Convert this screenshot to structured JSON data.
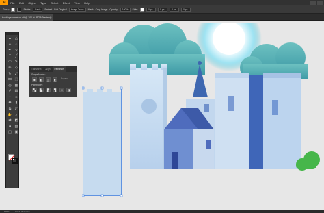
{
  "app": {
    "logo": "Ai"
  },
  "menu": [
    "File",
    "Edit",
    "Object",
    "Type",
    "Select",
    "Effect",
    "View",
    "Help"
  ],
  "control": {
    "group_label": "Group",
    "stroke_label": "Stroke:",
    "opacity_label": "Opacity:",
    "style_label": "Style:",
    "basic": "Basic",
    "image_trace": "Image Trace",
    "mask": "Mask",
    "crop_image": "Crop Image",
    "embed": "Embed",
    "edit_original": "Edit Original",
    "x_val": "0 px",
    "y_val": "0 px",
    "w_val": "0 px",
    "h_val": "0 px",
    "opacity_val": "100%"
  },
  "document_tab": {
    "title": "buildingsanimation.ai* @ 100 % (RGB/Preview)",
    "close": "×"
  },
  "tools": [
    {
      "name": "selection-tool",
      "glyph": "▲"
    },
    {
      "name": "direct-selection-tool",
      "glyph": "△"
    },
    {
      "name": "magic-wand-tool",
      "glyph": "✦"
    },
    {
      "name": "lasso-tool",
      "glyph": "◌"
    },
    {
      "name": "pen-tool",
      "glyph": "✒"
    },
    {
      "name": "curvature-tool",
      "glyph": "∿"
    },
    {
      "name": "type-tool",
      "glyph": "T"
    },
    {
      "name": "line-tool",
      "glyph": "╱"
    },
    {
      "name": "rectangle-tool",
      "glyph": "▭"
    },
    {
      "name": "paintbrush-tool",
      "glyph": "✎"
    },
    {
      "name": "pencil-tool",
      "glyph": "✏"
    },
    {
      "name": "eraser-tool",
      "glyph": "◇"
    },
    {
      "name": "rotate-tool",
      "glyph": "↻"
    },
    {
      "name": "scale-tool",
      "glyph": "⤢"
    },
    {
      "name": "width-tool",
      "glyph": "⋈"
    },
    {
      "name": "free-transform-tool",
      "glyph": "⬚"
    },
    {
      "name": "shape-builder-tool",
      "glyph": "◎"
    },
    {
      "name": "perspective-grid-tool",
      "glyph": "▦"
    },
    {
      "name": "mesh-tool",
      "glyph": "#"
    },
    {
      "name": "gradient-tool",
      "glyph": "▤"
    },
    {
      "name": "eyedropper-tool",
      "glyph": "⌖"
    },
    {
      "name": "blend-tool",
      "glyph": "∞"
    },
    {
      "name": "symbol-sprayer-tool",
      "glyph": "✺"
    },
    {
      "name": "graph-tool",
      "glyph": "▮"
    },
    {
      "name": "artboard-tool",
      "glyph": "⧉"
    },
    {
      "name": "slice-tool",
      "glyph": "◸"
    },
    {
      "name": "hand-tool",
      "glyph": "✋"
    },
    {
      "name": "zoom-tool",
      "glyph": "⌕"
    },
    {
      "name": "swap-fill-stroke",
      "glyph": "⇄"
    },
    {
      "name": "default-fill-stroke",
      "glyph": "◩"
    },
    {
      "name": "color-mode",
      "glyph": "■"
    },
    {
      "name": "gradient-mode",
      "glyph": "▧"
    },
    {
      "name": "draw-mode",
      "glyph": "◫"
    },
    {
      "name": "screen-mode",
      "glyph": "▣"
    }
  ],
  "pathfinder_panel": {
    "tabs": [
      "Transform",
      "Align",
      "Pathfinder"
    ],
    "active_tab": 2,
    "shape_modes": "Shape Modes:",
    "pathfinders": "Pathfinders:",
    "expand": "Expand"
  },
  "colors": {
    "sky_cloud": "#5fb8b8",
    "building_dark": "#3d5aa8",
    "building_light": "#c8dcf0",
    "tree_green": "#46b64a"
  },
  "status": {
    "zoom": "100%",
    "tool_name": "Hand / Selection"
  }
}
